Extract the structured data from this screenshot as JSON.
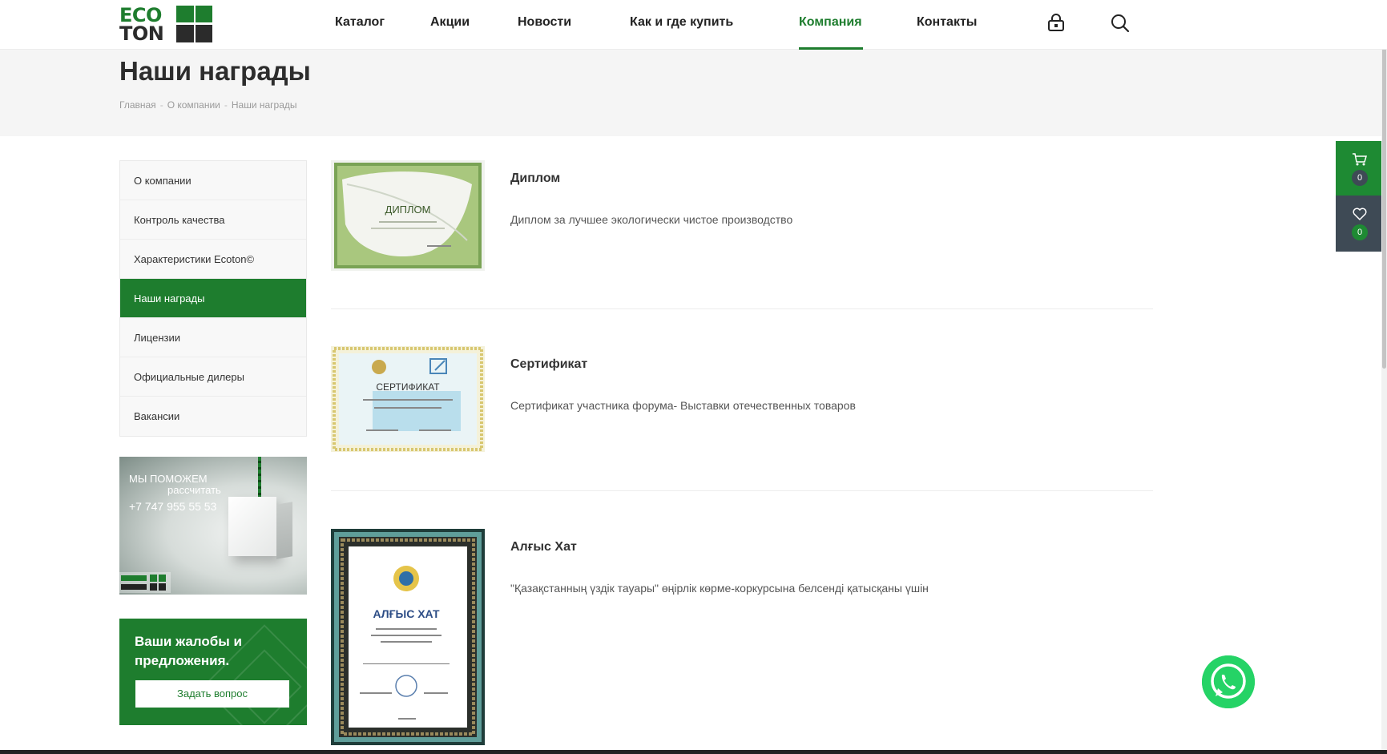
{
  "brand": {
    "logo_top": "ECO",
    "logo_bottom": "TON",
    "accent": "#1e7d2e",
    "dark": "#2b2b2b"
  },
  "nav": {
    "items": [
      {
        "label": "Каталог"
      },
      {
        "label": "Акции"
      },
      {
        "label": "Новости"
      },
      {
        "label": "Как и где купить"
      },
      {
        "label": "Компания",
        "active": true
      },
      {
        "label": "Контакты"
      }
    ],
    "cart_icon": "bag-lock-icon",
    "search_icon": "search-icon"
  },
  "page": {
    "title": "Наши награды",
    "breadcrumb": [
      "Главная",
      "О компании",
      "Наши награды"
    ]
  },
  "sidebar": {
    "items": [
      {
        "label": "О компании"
      },
      {
        "label": "Контроль качества"
      },
      {
        "label": "Характеристики Ecoton©"
      },
      {
        "label": "Наши награды",
        "active": true
      },
      {
        "label": "Лицензии"
      },
      {
        "label": "Официальные дилеры"
      },
      {
        "label": "Вакансии"
      }
    ]
  },
  "promo": {
    "line1": "МЫ ПОМОЖЕМ",
    "line2": "рассчитать",
    "phone": "+7 747 955 55 53"
  },
  "feedback": {
    "title": "Ваши жалобы и предложения.",
    "button": "Задать вопрос"
  },
  "awards": [
    {
      "title": "Диплом",
      "description": "Диплом за лучшее экологически чистое производство",
      "image_caption": "ДИПЛОМ"
    },
    {
      "title": "Сертификат",
      "description": "Сертификат участника форума- Выставки отечественных товаров",
      "image_caption": "СЕРТИФИКАТ"
    },
    {
      "title": "Алғыс Хат",
      "description": "\"Қазақстанның үздік тауары\" өңірлік көрме-коркурсына белсенді қатысқаны үшін",
      "image_caption": "АЛҒЫС ХАТ"
    }
  ],
  "widgets": {
    "cart_count": "0",
    "favorites_count": "0"
  }
}
